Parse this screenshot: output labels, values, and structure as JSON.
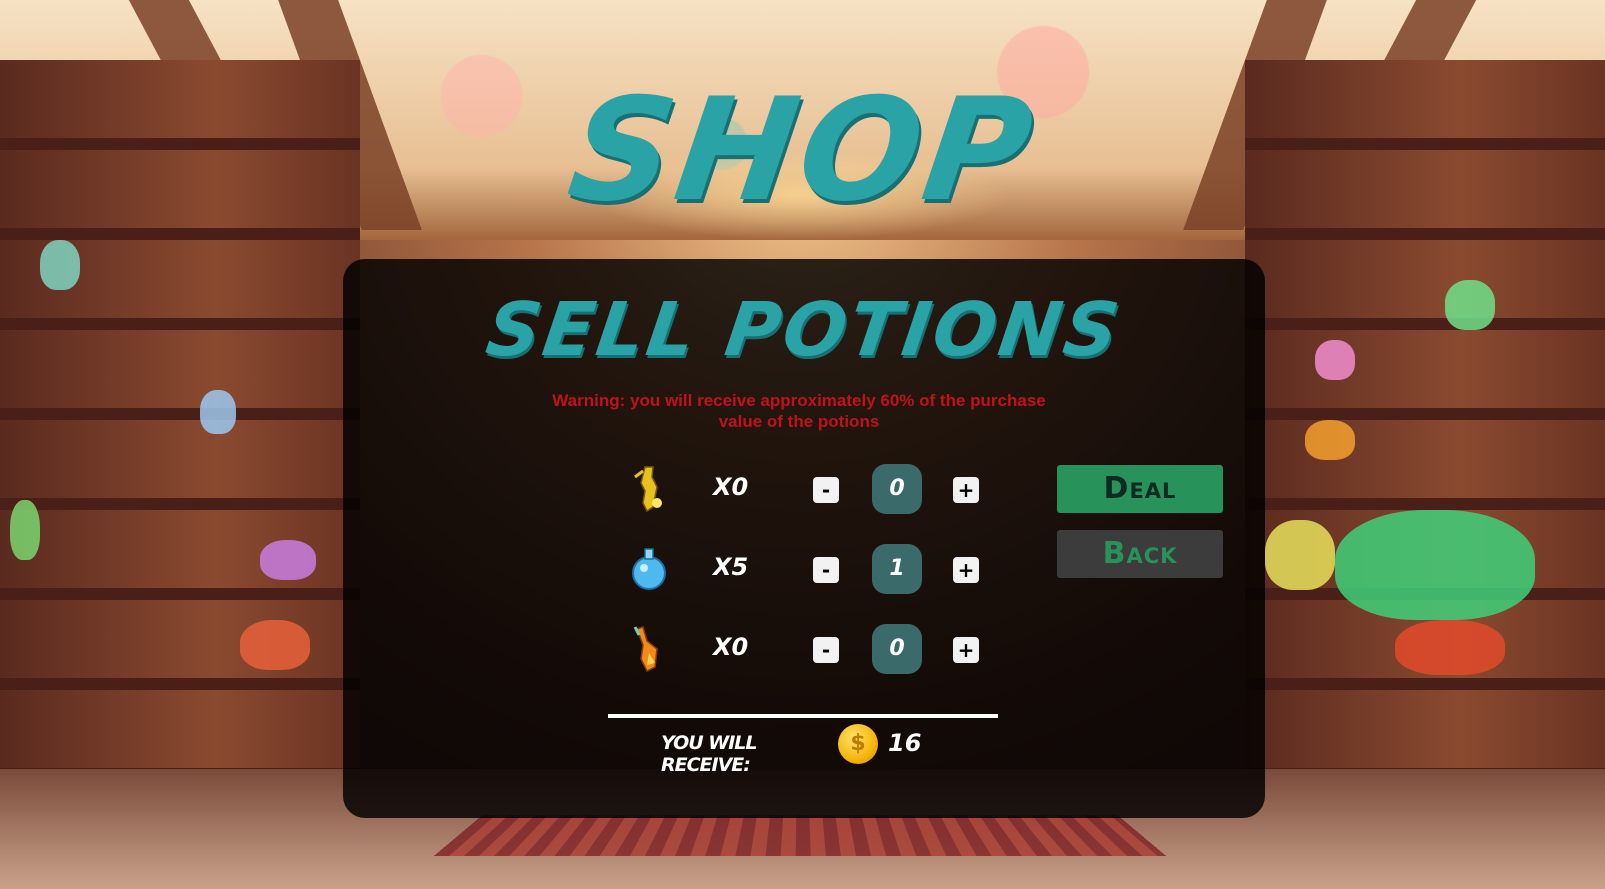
{
  "title": "SHOP",
  "panel": {
    "title": "SELL POTIONS",
    "warning": "Warning: you will receive approximately 60% of the purchase value of the potions"
  },
  "potions": [
    {
      "icon": "yellow-potion-icon",
      "count": "X0",
      "quantity": "0",
      "minus": "-",
      "plus": "+"
    },
    {
      "icon": "blue-potion-icon",
      "count": "X5",
      "quantity": "1",
      "minus": "-",
      "plus": "+"
    },
    {
      "icon": "orange-potion-icon",
      "count": "X0",
      "quantity": "0",
      "minus": "-",
      "plus": "+"
    }
  ],
  "receive": {
    "label": "YOU WILL RECEIVE:",
    "coin_symbol": "$",
    "amount": "16"
  },
  "buttons": {
    "deal": "Deal",
    "back": "Back"
  },
  "colors": {
    "title": "#2aa3a6",
    "warning": "#c0121c",
    "deal_bg": "#27935b",
    "back_bg": "#3c3c3c",
    "qty_bg": "#3b6a6b",
    "coin": "#f5b50b"
  }
}
